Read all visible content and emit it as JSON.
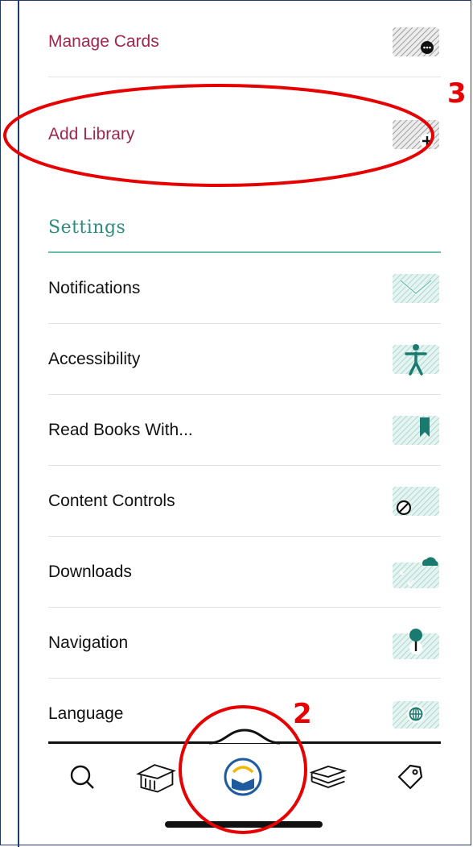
{
  "account_items": [
    {
      "label": "Manage Cards",
      "icon": "more-dots-icon"
    },
    {
      "label": "Add Library",
      "icon": "plus-icon"
    }
  ],
  "settings": {
    "title": "Settings",
    "items": [
      {
        "label": "Notifications",
        "icon": "envelope-icon"
      },
      {
        "label": "Accessibility",
        "icon": "accessibility-person-icon"
      },
      {
        "label": "Read Books With...",
        "icon": "bookmark-icon"
      },
      {
        "label": "Content Controls",
        "icon": "prohibited-icon"
      },
      {
        "label": "Downloads",
        "icon": "cloud-download-icon"
      },
      {
        "label": "Navigation",
        "icon": "pushpin-icon"
      },
      {
        "label": "Language",
        "icon": "globe-icon"
      }
    ]
  },
  "tabbar": {
    "items": [
      {
        "name": "search",
        "icon": "search-icon"
      },
      {
        "name": "libraries",
        "icon": "library-building-icon"
      },
      {
        "name": "home",
        "icon": "home-app-icon"
      },
      {
        "name": "shelf",
        "icon": "books-stack-icon"
      },
      {
        "name": "tags",
        "icon": "tag-icon"
      }
    ]
  },
  "annotations": {
    "marker_2": "2",
    "marker_3": "3"
  },
  "colors": {
    "accent": "#a1264b",
    "teal": "#2e8b80",
    "teal_light": "#cde8e3",
    "annotation": "#e60000"
  }
}
